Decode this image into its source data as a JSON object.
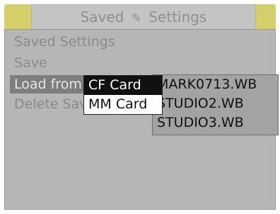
{
  "header": {
    "title_left": "Saved",
    "title_icon": "pencil-icon",
    "title_right": "Settings"
  },
  "menu": {
    "items": [
      {
        "label": "Saved Settings"
      },
      {
        "label": "Save"
      },
      {
        "label": "Load from"
      },
      {
        "label": "Delete Saved"
      }
    ],
    "selected_index": 2
  },
  "source_submenu": {
    "items": [
      {
        "label": "CF Card",
        "selected": true
      },
      {
        "label": "MM Card",
        "selected": false
      }
    ]
  },
  "files": {
    "items": [
      {
        "label": "MARK0713.WB"
      },
      {
        "label": "STUDIO2.WB"
      },
      {
        "label": "STUDIO3.WB"
      }
    ]
  },
  "colors": {
    "frame_accent": "#d4cf6a",
    "panel": "#b6b6b6",
    "highlight": "#7e7e7e"
  }
}
